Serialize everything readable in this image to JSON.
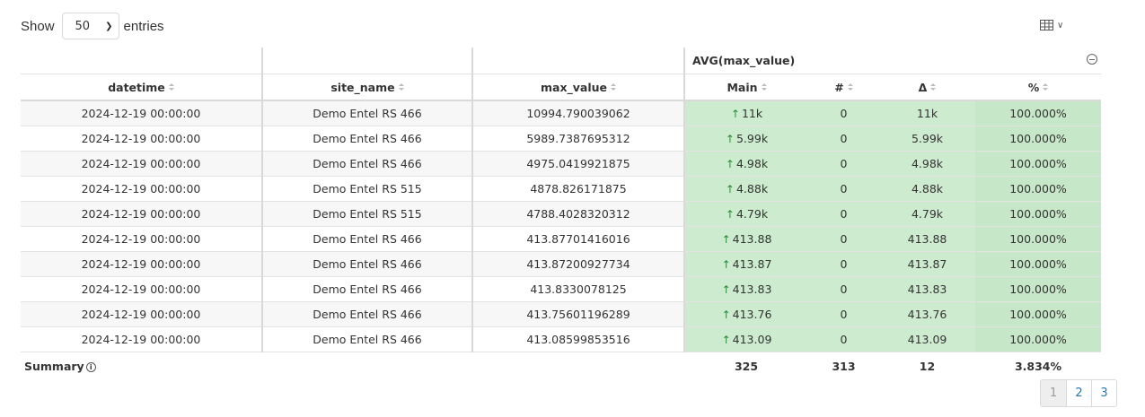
{
  "length_control": {
    "prefix": "Show",
    "value": "50",
    "suffix": "entries"
  },
  "table": {
    "group_header": "AVG(max_value)",
    "columns": [
      "datetime",
      "site_name",
      "max_value",
      "Main",
      "#",
      "Δ",
      "%"
    ],
    "rows": [
      [
        "2024-12-19 00:00:00",
        "Demo Entel RS 466",
        "10994.790039062",
        "11k",
        "0",
        "11k",
        "100.000%"
      ],
      [
        "2024-12-19 00:00:00",
        "Demo Entel RS 466",
        "5989.7387695312",
        "5.99k",
        "0",
        "5.99k",
        "100.000%"
      ],
      [
        "2024-12-19 00:00:00",
        "Demo Entel RS 466",
        "4975.0419921875",
        "4.98k",
        "0",
        "4.98k",
        "100.000%"
      ],
      [
        "2024-12-19 00:00:00",
        "Demo Entel RS 515",
        "4878.826171875",
        "4.88k",
        "0",
        "4.88k",
        "100.000%"
      ],
      [
        "2024-12-19 00:00:00",
        "Demo Entel RS 515",
        "4788.4028320312",
        "4.79k",
        "0",
        "4.79k",
        "100.000%"
      ],
      [
        "2024-12-19 00:00:00",
        "Demo Entel RS 466",
        "413.87701416016",
        "413.88",
        "0",
        "413.88",
        "100.000%"
      ],
      [
        "2024-12-19 00:00:00",
        "Demo Entel RS 466",
        "413.87200927734",
        "413.87",
        "0",
        "413.87",
        "100.000%"
      ],
      [
        "2024-12-19 00:00:00",
        "Demo Entel RS 466",
        "413.8330078125",
        "413.83",
        "0",
        "413.83",
        "100.000%"
      ],
      [
        "2024-12-19 00:00:00",
        "Demo Entel RS 466",
        "413.75601196289",
        "413.76",
        "0",
        "413.76",
        "100.000%"
      ],
      [
        "2024-12-19 00:00:00",
        "Demo Entel RS 466",
        "413.08599853516",
        "413.09",
        "0",
        "413.09",
        "100.000%"
      ]
    ],
    "summary": {
      "label": "Summary",
      "main": "325",
      "count": "313",
      "delta": "12",
      "percent": "3.834%"
    }
  },
  "pagination": {
    "pages": [
      "1",
      "2",
      "3"
    ],
    "active": "1"
  },
  "icons": {
    "column_toggle": "table-grid-icon",
    "collapse": "minus-circle-icon",
    "sort": "sort-icon",
    "trend": "arrow-up-icon",
    "info": "info-icon"
  },
  "colors": {
    "highlight_green": "#cdebcf",
    "trend_up": "#2b8a3e",
    "link": "#1f77b4"
  }
}
